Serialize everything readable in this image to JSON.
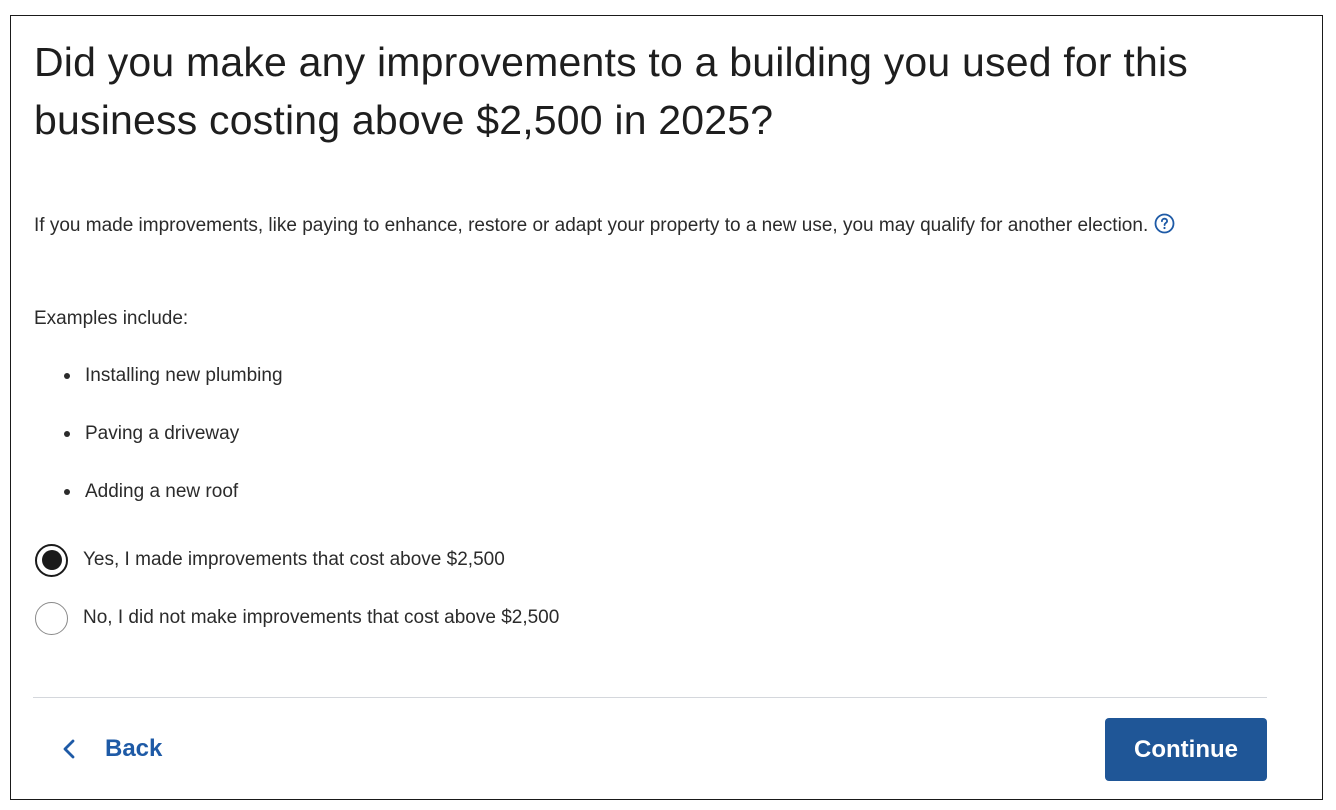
{
  "question": {
    "title": "Did you make any improvements to a building you used for this business costing above $2,500 in 2025?",
    "intro": "If you made improvements, like paying to enhance, restore or adapt your property to a new use, you may qualify for another election."
  },
  "examples": {
    "label": "Examples include:",
    "items": [
      "Installing new plumbing",
      "Paving a driveway",
      "Adding a new roof"
    ]
  },
  "options": [
    {
      "label": "Yes, I made improvements that cost above $2,500",
      "selected": true
    },
    {
      "label": "No, I did not make improvements that cost above $2,500",
      "selected": false
    }
  ],
  "footer": {
    "back_label": "Back",
    "continue_label": "Continue"
  },
  "colors": {
    "primary_button": "#1f5697",
    "link": "#1e5aa6",
    "help_icon": "#1e5aa6"
  },
  "icons": {
    "help": "question-circle-icon",
    "back": "chevron-left-icon"
  }
}
